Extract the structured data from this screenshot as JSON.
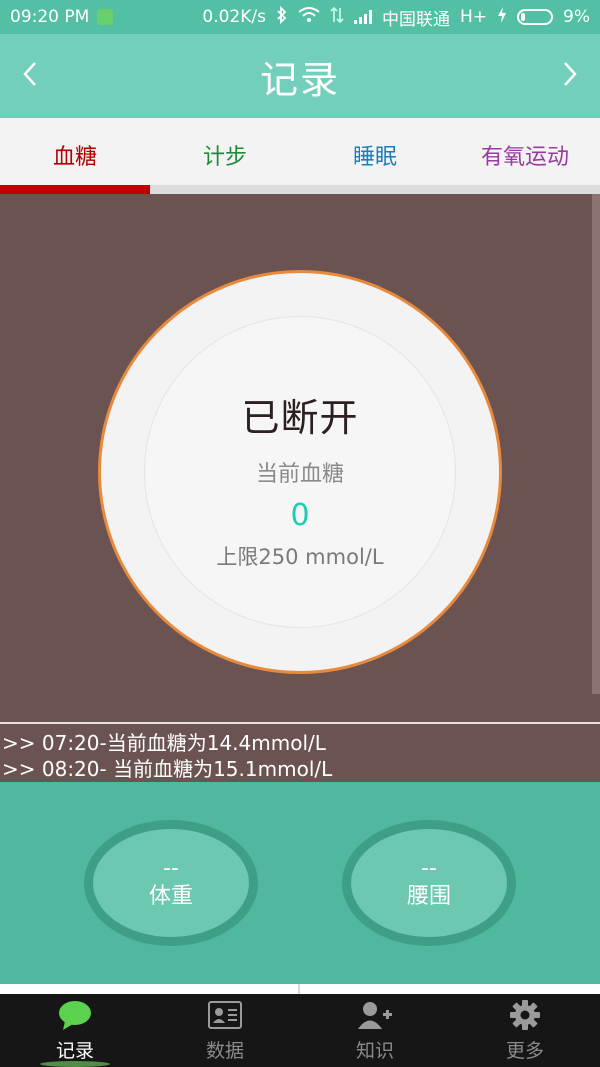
{
  "status_bar": {
    "time": "09:20 PM",
    "speed": "0.02K/s",
    "carrier": "中国联通",
    "network": "H+",
    "battery": "9%"
  },
  "header": {
    "title": "记录",
    "back_icon": "chevron-left-icon",
    "forward_icon": "chevron-right-icon"
  },
  "tabs": [
    {
      "label": "血糖",
      "color": "#b00000",
      "active": true
    },
    {
      "label": "计步",
      "color": "#1f8a3a",
      "active": false
    },
    {
      "label": "睡眠",
      "color": "#1a7fc0",
      "active": false
    },
    {
      "label": "有氧运动",
      "color": "#9a3aa0",
      "active": false
    }
  ],
  "gauge": {
    "status": "已断开",
    "current_label": "当前血糖",
    "current_value": "0",
    "limit_text": "上限250 mmol/L"
  },
  "logs": [
    ">> 07:20-当前血糖为14.4mmol/L",
    ">> 08:20- 当前血糖为15.1mmol/L"
  ],
  "measure": {
    "weight": {
      "value": "--",
      "label": "体重"
    },
    "waist": {
      "value": "--",
      "label": "腰围"
    }
  },
  "bottom_nav": [
    {
      "label": "记录",
      "icon": "chat-bubble-icon",
      "active": true
    },
    {
      "label": "数据",
      "icon": "id-card-icon",
      "active": false
    },
    {
      "label": "知识",
      "icon": "add-user-icon",
      "active": false
    },
    {
      "label": "更多",
      "icon": "gear-icon",
      "active": false
    }
  ],
  "colors": {
    "accent": "#72cfbb",
    "main_bg": "#6b5351",
    "ring_border": "#e88a3d",
    "value": "#19cfb2"
  }
}
